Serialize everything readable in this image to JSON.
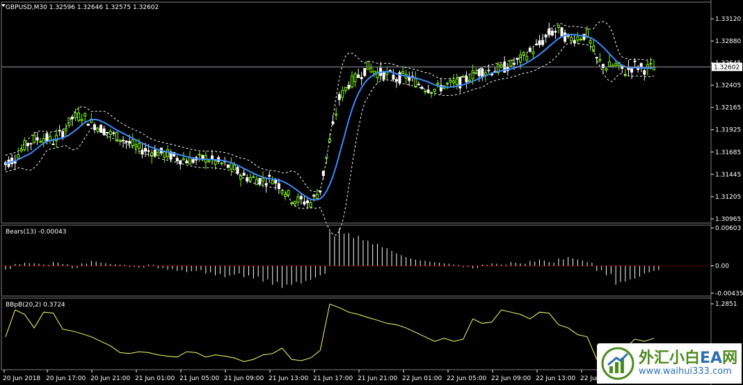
{
  "chart_data": [
    {
      "type": "candlestick",
      "title": "GBPUSD,M30  1.32596 1.32646 1.32575 1.32602",
      "current_price_label": "1.32602",
      "y_ticks": [
        "1.33120",
        "1.32880",
        "1.32645",
        "1.32405",
        "1.32165",
        "1.31925",
        "1.31685",
        "1.31445",
        "1.31205",
        "1.30965"
      ],
      "ylim": [
        1.30965,
        1.3324
      ],
      "x_ticks": [
        "20 Jun 2018",
        "20 Jun 17:00",
        "20 Jun 21:00",
        "21 Jun 01:00",
        "21 Jun 05:00",
        "21 Jun 09:00",
        "21 Jun 13:00",
        "21 Jun 17:00",
        "21 Jun 21:00",
        "22 Jun 01:00",
        "22 Jun 05:00",
        "22 Jun 09:00",
        "22 Jun 13:00",
        "22 Jun 17:00"
      ],
      "close_path": [
        1.3156,
        1.3162,
        1.3175,
        1.3182,
        1.3184,
        1.318,
        1.319,
        1.3205,
        1.3208,
        1.32,
        1.3194,
        1.3188,
        1.3184,
        1.3178,
        1.3172,
        1.317,
        1.3168,
        1.3166,
        1.3162,
        1.316,
        1.316,
        1.3162,
        1.3158,
        1.3155,
        1.315,
        1.3142,
        1.314,
        1.3138,
        1.314,
        1.313,
        1.3118,
        1.3116,
        1.3114,
        1.3128,
        1.318,
        1.3226,
        1.3242,
        1.325,
        1.326,
        1.3254,
        1.3252,
        1.3248,
        1.325,
        1.3244,
        1.3238,
        1.3236,
        1.324,
        1.3242,
        1.3244,
        1.3252,
        1.3256,
        1.3256,
        1.3258,
        1.3262,
        1.3268,
        1.3276,
        1.3284,
        1.3296,
        1.33,
        1.329,
        1.3292,
        1.3295,
        1.3268,
        1.326,
        1.3262,
        1.3255,
        1.3262,
        1.3258,
        1.326
      ],
      "indicators": [
        "Bollinger Bands (20,2)",
        "Moving Average"
      ]
    },
    {
      "type": "histogram",
      "title": "Bears(13) -0.00043",
      "y_ticks": [
        "0.00603",
        "0.00",
        "-0.00435"
      ],
      "ylim": [
        -0.00435,
        0.00603
      ],
      "values": [
        -0.0006,
        0.0003,
        0.0005,
        0.0004,
        0.0002,
        0.0006,
        0.0003,
        -0.0004,
        0.0004,
        0.0008,
        0.0005,
        0.0003,
        0.0002,
        -0.0002,
        -0.0003,
        0.0002,
        -0.0004,
        -0.0006,
        -0.0008,
        -0.001,
        -0.0008,
        -0.0012,
        -0.0015,
        -0.0018,
        -0.0014,
        -0.0018,
        -0.002,
        -0.0025,
        -0.003,
        -0.0035,
        -0.003,
        -0.0028,
        -0.0022,
        -0.0015,
        0.0055,
        0.006,
        0.0052,
        0.0048,
        0.004,
        0.0035,
        0.0028,
        0.002,
        0.0014,
        0.001,
        0.0008,
        0.0006,
        0.0004,
        0.0002,
        -0.0002,
        -0.0004,
        0.0002,
        0.0004,
        0.0002,
        0.0006,
        0.0004,
        0.0008,
        0.001,
        0.0006,
        0.0012,
        0.0014,
        0.001,
        0.0006,
        -0.0008,
        -0.0015,
        -0.003,
        -0.0025,
        -0.002,
        -0.0012,
        -0.0008
      ]
    },
    {
      "type": "line",
      "title": "BBpB(20,2) 0.3724",
      "y_ticks": [
        "1.2851"
      ],
      "ylim": [
        -0.15,
        1.35
      ],
      "values": [
        0.55,
        1.15,
        1.05,
        0.75,
        1.1,
        1.08,
        0.72,
        0.68,
        0.62,
        0.55,
        0.45,
        0.35,
        0.2,
        0.18,
        0.22,
        0.2,
        0.15,
        0.12,
        0.1,
        0.22,
        0.2,
        0.1,
        0.15,
        0.12,
        0.08,
        0.0,
        0.05,
        0.15,
        0.18,
        0.3,
        0.05,
        0.02,
        0.08,
        0.25,
        1.28,
        1.2,
        1.1,
        1.05,
        0.98,
        0.92,
        0.85,
        0.82,
        0.75,
        0.65,
        0.55,
        0.45,
        0.52,
        0.45,
        0.5,
        0.95,
        0.85,
        0.88,
        1.15,
        1.1,
        1.05,
        0.95,
        1.1,
        1.08,
        0.82,
        0.75,
        0.6,
        0.55,
        0.05,
        0.2,
        0.4,
        0.3,
        0.5,
        0.45,
        0.52
      ]
    }
  ],
  "watermark": {
    "brand": "外汇小白",
    "brand_ea": "EA",
    "brand_net": "网",
    "url": "www.waihui333.com"
  },
  "colors": {
    "background": "#000000",
    "bull_candle": "#7cfc00",
    "bear_candle": "#ffffff",
    "moving_average": "#3d8bff",
    "bollinger": "#ffffff",
    "zero_line": "#b00000",
    "bbpb_line": "#ffff66"
  }
}
